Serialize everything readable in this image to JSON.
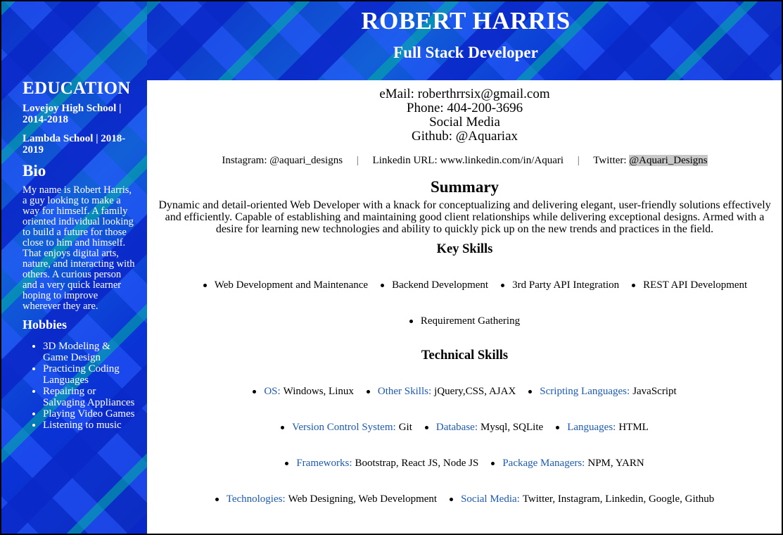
{
  "header": {
    "name": "ROBERT HARRIS",
    "title": "Full Stack Developer"
  },
  "sidebar": {
    "education_heading": "EDUCATION",
    "schools": [
      "Lovejoy High School | 2014-2018",
      "Lambda School | 2018-2019"
    ],
    "bio_heading": "Bio",
    "bio_text": "My name is Robert Harris, a guy looking to make a way for himself. A family oriented individual looking to build a future for those close to him and himself. That enjoys digital arts, nature, and interacting with others. A curious person and a very quick learner hoping to improve wherever they are.",
    "hobbies_heading": "Hobbies",
    "hobbies": [
      "3D Modeling & Game Design",
      "Practicing Coding Languages",
      "Repairing or Salvaging Appliances",
      "Playing Video Games",
      "Listening to music"
    ]
  },
  "contact": {
    "email": "eMail: roberthrrsix@gmail.com",
    "phone": "Phone: 404-200-3696",
    "social_media": "Social Media",
    "github": "Github: @Aquariax",
    "instagram": "Instagram: @aquari_designs",
    "separator": "|",
    "linkedin": "Linkedin URL: www.linkedin.com/in/Aquari",
    "twitter_label": "Twitter: ",
    "twitter_handle": "@Aquari_Designs"
  },
  "summary": {
    "heading": "Summary",
    "text": "Dynamic and detail-oriented Web Developer with a knack for conceptualizing and delivering elegant, user-friendly solutions effectively and efficiently. Capable of establishing and maintaining good client relationships while delivering exceptional designs. Armed with a desire for learning new technologies and ability to quickly pick up on the new trends and practices in the field."
  },
  "key_skills": {
    "heading": "Key Skills",
    "items": [
      "Web Development and Maintenance",
      "Backend Development",
      "3rd Party API Integration",
      "REST API Development",
      "Requirement Gathering"
    ]
  },
  "technical_skills": {
    "heading": "Technical Skills",
    "items": [
      {
        "label": "OS:",
        "value": "Windows, Linux"
      },
      {
        "label": "Other Skills:",
        "value": "jQuery,CSS, AJAX"
      },
      {
        "label": "Scripting Languages:",
        "value": "JavaScript"
      },
      {
        "label": "Version Control System:",
        "value": "Git"
      },
      {
        "label": "Database:",
        "value": "Mysql, SQLite"
      },
      {
        "label": "Languages:",
        "value": "HTML"
      },
      {
        "label": "Frameworks:",
        "value": "Bootstrap, React JS, Node JS"
      },
      {
        "label": "Package Managers:",
        "value": "NPM, YARN"
      },
      {
        "label": "Technologies:",
        "value": "Web Designing, Web Development"
      },
      {
        "label": "Social Media:",
        "value": "Twitter, Instagram, Linkedin, Google, Github"
      }
    ]
  },
  "colors": {
    "label_blue": "#1c5ab5",
    "banner_blue": "#0a35d8",
    "highlight_gray": "#c8c8c8"
  }
}
